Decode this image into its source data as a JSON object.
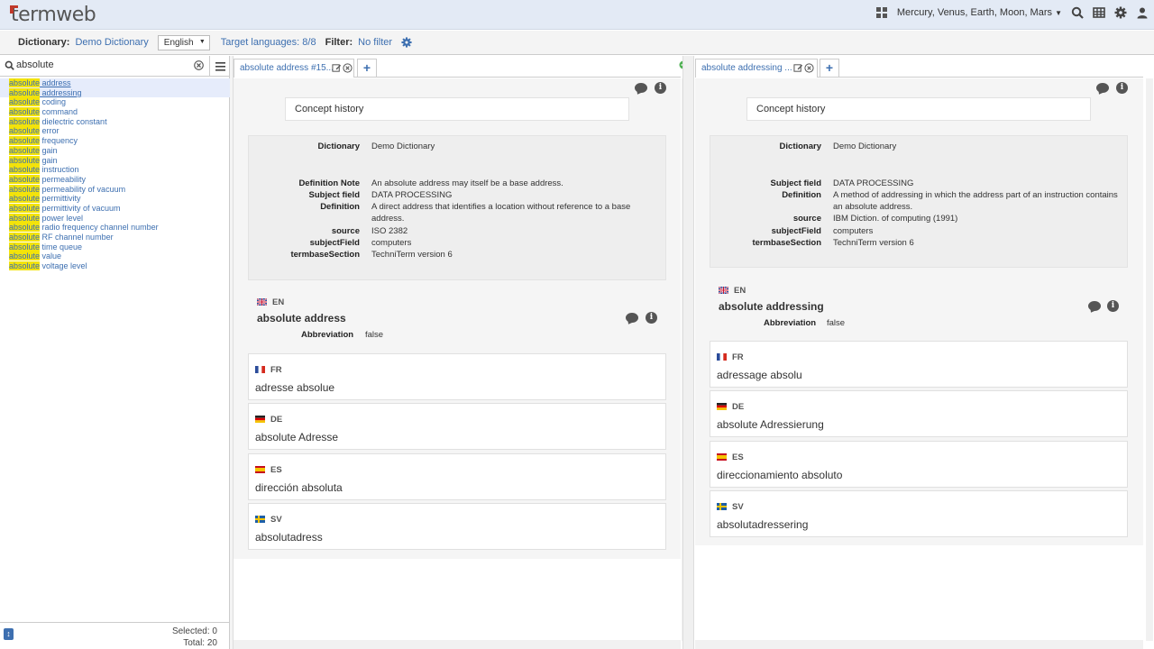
{
  "app": {
    "logo": "termweb"
  },
  "header": {
    "databases": "Mercury, Venus, Earth, Moon, Mars"
  },
  "toolbar": {
    "dictionary_label": "Dictionary",
    "dictionary_value": "Demo Dictionary",
    "language": "English",
    "target_languages": "Target languages: 8/8",
    "filter_label": "Filter:",
    "filter_value": "No filter"
  },
  "search": {
    "value": "absolute",
    "placeholder": ""
  },
  "results": [
    {
      "hl": "absolute",
      "rest": " address"
    },
    {
      "hl": "absolute",
      "rest": " addressing"
    },
    {
      "hl": "absolute",
      "rest": " coding"
    },
    {
      "hl": "absolute",
      "rest": " command"
    },
    {
      "hl": "absolute",
      "rest": " dielectric constant"
    },
    {
      "hl": "absolute",
      "rest": " error"
    },
    {
      "hl": "absolute",
      "rest": " frequency"
    },
    {
      "hl": "absolute",
      "rest": " gain"
    },
    {
      "hl": "absolute",
      "rest": " gain"
    },
    {
      "hl": "absolute",
      "rest": " instruction"
    },
    {
      "hl": "absolute",
      "rest": " permeability"
    },
    {
      "hl": "absolute",
      "rest": " permeability of vacuum"
    },
    {
      "hl": "absolute",
      "rest": " permittivity"
    },
    {
      "hl": "absolute",
      "rest": " permittivity of vacuum"
    },
    {
      "hl": "absolute",
      "rest": " power level"
    },
    {
      "hl": "absolute",
      "rest": " radio frequency channel number"
    },
    {
      "hl": "absolute",
      "rest": " RF channel number"
    },
    {
      "hl": "absolute",
      "rest": " time queue"
    },
    {
      "hl": "absolute",
      "rest": " value"
    },
    {
      "hl": "absolute",
      "rest": " voltage level"
    }
  ],
  "footer": {
    "selected": "Selected: 0",
    "total": "Total: 20"
  },
  "pane1": {
    "tab_label": "absolute address #15...",
    "concept_history": "Concept history",
    "meta": [
      {
        "key": "Dictionary",
        "value": "Demo Dictionary"
      },
      {
        "key": "Definition Note",
        "value": "An absolute address may itself be a base address."
      },
      {
        "key": "Subject field",
        "value": "DATA PROCESSING"
      },
      {
        "key": "Definition",
        "value": "A direct address that identifies a location without reference to a base"
      },
      {
        "key": "",
        "value": "address."
      },
      {
        "key": "source",
        "value": "ISO 2382"
      },
      {
        "key": "subjectField",
        "value": "computers"
      },
      {
        "key": "termbaseSection",
        "value": "TechniTerm version 6"
      }
    ],
    "main_lang": "EN",
    "main_term": "absolute address",
    "abbr_label": "Abbreviation",
    "abbr_value": "false",
    "languages": [
      {
        "code": "FR",
        "term": "adresse absolue"
      },
      {
        "code": "DE",
        "term": "absolute Adresse"
      },
      {
        "code": "ES",
        "term": "dirección absoluta"
      },
      {
        "code": "SV",
        "term": "absolutadress"
      }
    ]
  },
  "pane2": {
    "tab_label": "absolute addressing ...",
    "concept_history": "Concept history",
    "meta": [
      {
        "key": "Dictionary",
        "value": "Demo Dictionary"
      },
      {
        "key": "Subject field",
        "value": "DATA PROCESSING"
      },
      {
        "key": "Definition",
        "value": "A method of addressing in which the address part of an instruction contains"
      },
      {
        "key": "",
        "value": "an absolute address."
      },
      {
        "key": "source",
        "value": "IBM Diction. of computing (1991)"
      },
      {
        "key": "subjectField",
        "value": "computers"
      },
      {
        "key": "termbaseSection",
        "value": "TechniTerm version 6"
      }
    ],
    "main_lang": "EN",
    "main_term": "absolute addressing",
    "abbr_label": "Abbreviation",
    "abbr_value": "false",
    "languages": [
      {
        "code": "FR",
        "term": "adressage absolu"
      },
      {
        "code": "DE",
        "term": "absolute Adressierung"
      },
      {
        "code": "ES",
        "term": "direccionamiento absoluto"
      },
      {
        "code": "SV",
        "term": "absolutadressering"
      }
    ]
  },
  "colors": {
    "accent": "#3d6fb0",
    "highlight": "#f3e30a",
    "header_bg": "#e3eaf5"
  }
}
